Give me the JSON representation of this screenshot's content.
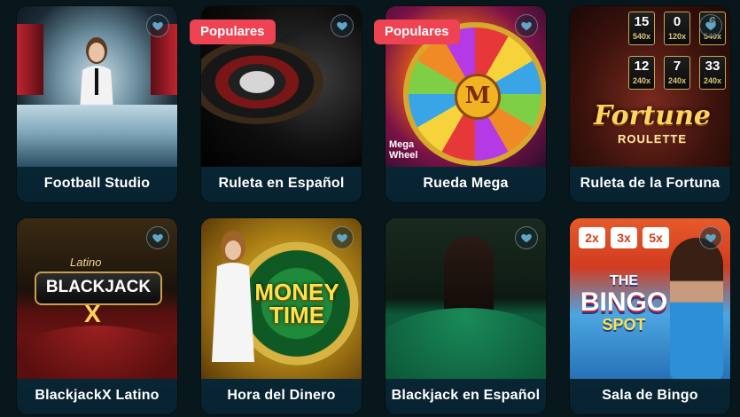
{
  "games": [
    {
      "title": "Football Studio",
      "badge": ""
    },
    {
      "title": "Ruleta en Español",
      "badge": "Populares"
    },
    {
      "title": "Rueda Mega",
      "badge": "Populares"
    },
    {
      "title": "Ruleta de la Fortuna",
      "badge": ""
    },
    {
      "title": "BlackjackX Latino",
      "badge": ""
    },
    {
      "title": "Hora del Dinero",
      "badge": ""
    },
    {
      "title": "Blackjack en Español",
      "badge": ""
    },
    {
      "title": "Sala de Bingo",
      "badge": ""
    }
  ],
  "art": {
    "rueda_mega_center": "M",
    "rueda_mega_logo": "Mega Wheel",
    "fortune_logo": "Fortune",
    "fortune_sub": "ROULETTE",
    "fortune_tiles": [
      {
        "num": "15",
        "mult": "540x"
      },
      {
        "num": "0",
        "mult": "120x"
      },
      {
        "num": "6",
        "mult": "540x"
      },
      {
        "num": "12",
        "mult": "240x"
      },
      {
        "num": "7",
        "mult": "240x"
      },
      {
        "num": "33",
        "mult": "240x"
      }
    ],
    "blackjack_latino": "Latino",
    "blackjack_logo": "BLACKJACK",
    "blackjack_x": "X",
    "money_time": "MONEY TIME",
    "bingo_the": "THE",
    "bingo_title": "BINGO",
    "bingo_spot": "SPOT",
    "bingo_tiles": [
      "2x",
      "3x",
      "5x"
    ]
  },
  "colors": {
    "background": "#08171b",
    "badge": "#ee4352",
    "card": "#0f3a4d"
  },
  "icons": {
    "favorite": "heart-icon"
  }
}
